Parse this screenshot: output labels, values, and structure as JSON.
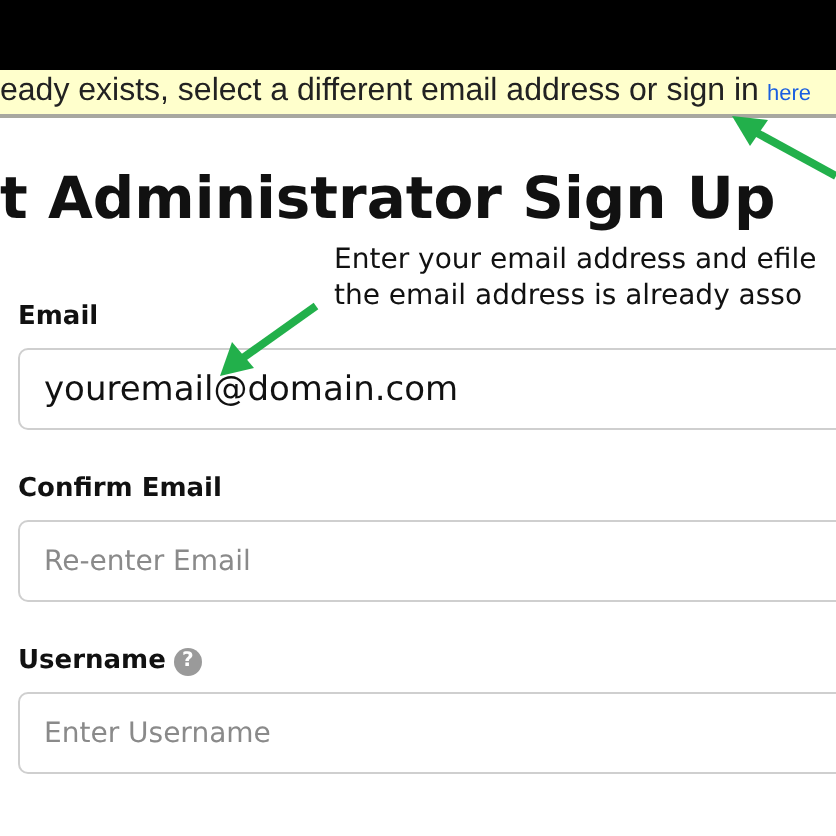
{
  "banner": {
    "message": "eady exists, select a different email address or sign in",
    "link": "here"
  },
  "title": "t Administrator Sign Up",
  "hint_lines": [
    "Enter your email address and efile",
    "the email address is already asso"
  ],
  "fields": [
    {
      "label": "Email",
      "value": "youremail@domain.com"
    },
    {
      "label": "Confirm Email",
      "placeholder": "Re-enter Email"
    },
    {
      "label": "Username",
      "help": "?",
      "placeholder": "Enter Username"
    }
  ]
}
